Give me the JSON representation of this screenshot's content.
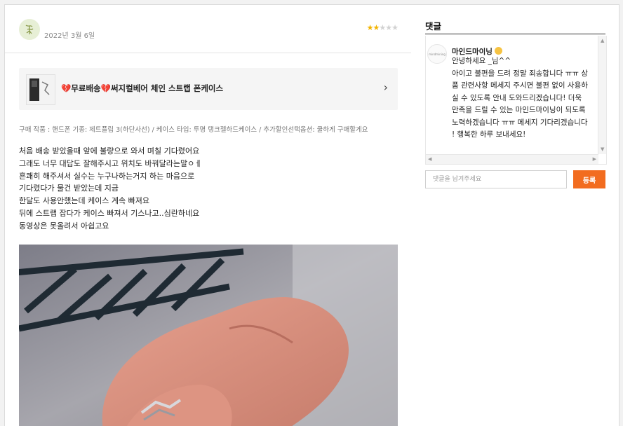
{
  "review": {
    "date": "2022년 3월 6일",
    "rating": 2,
    "rating_max": 5,
    "product": {
      "name": "💔무료배송💔써지컬베어 체인 스트랩 폰케이스"
    },
    "option": "구매 작품 : 핸드폰 기종: 제트플립 3(하단사선) / 케이스 타입: 투명 탱크젤하드케이스 / 추가할인선택옵션: 쿨하게 구매할게요",
    "body_lines": [
      "처음 배송 받았을때 앞에 불량으로 와서 며칠 기다렸어요",
      "그래도 너무 대답도 잘해주시고 위치도 바꿔달라는말ㅇㅔ",
      "흔쾌히 해주셔서 실수는 누구나하는거지 하는 마음으로",
      "기다렸다가 물건 받았는데 지금",
      "한달도 사용안했는데 케이스 계속 빠져요",
      "뒤에 스트랩 잡다가 케이스 빠져서 기스나고..심란하네요",
      "동영상은 못올려서 아쉽고요"
    ]
  },
  "comments": {
    "title": "댓글",
    "items": [
      {
        "author": "마인드마이닝",
        "avatar_text": "mindmining",
        "lines": [
          "안녕하세요 _님^^",
          "아이고 불편을 드려 정말 죄송합니다 ㅠㅠ 상",
          "품 관련사항 메세지 주시면 불편 없이 사용하",
          "실 수 있도록 안내 도와드리겠습니다! 더욱",
          "만족을 드릴 수 있는 마인드마이닝이 되도록",
          "노력하겠습니다 ㅠㅠ 메세지 기다리겠습니다",
          "! 행복한 하루 보내세요!"
        ]
      }
    ],
    "input_placeholder": "댓글을 남겨주세요",
    "submit_label": "등록"
  },
  "colors": {
    "accent": "#f26c1f",
    "star": "#f3b400"
  }
}
